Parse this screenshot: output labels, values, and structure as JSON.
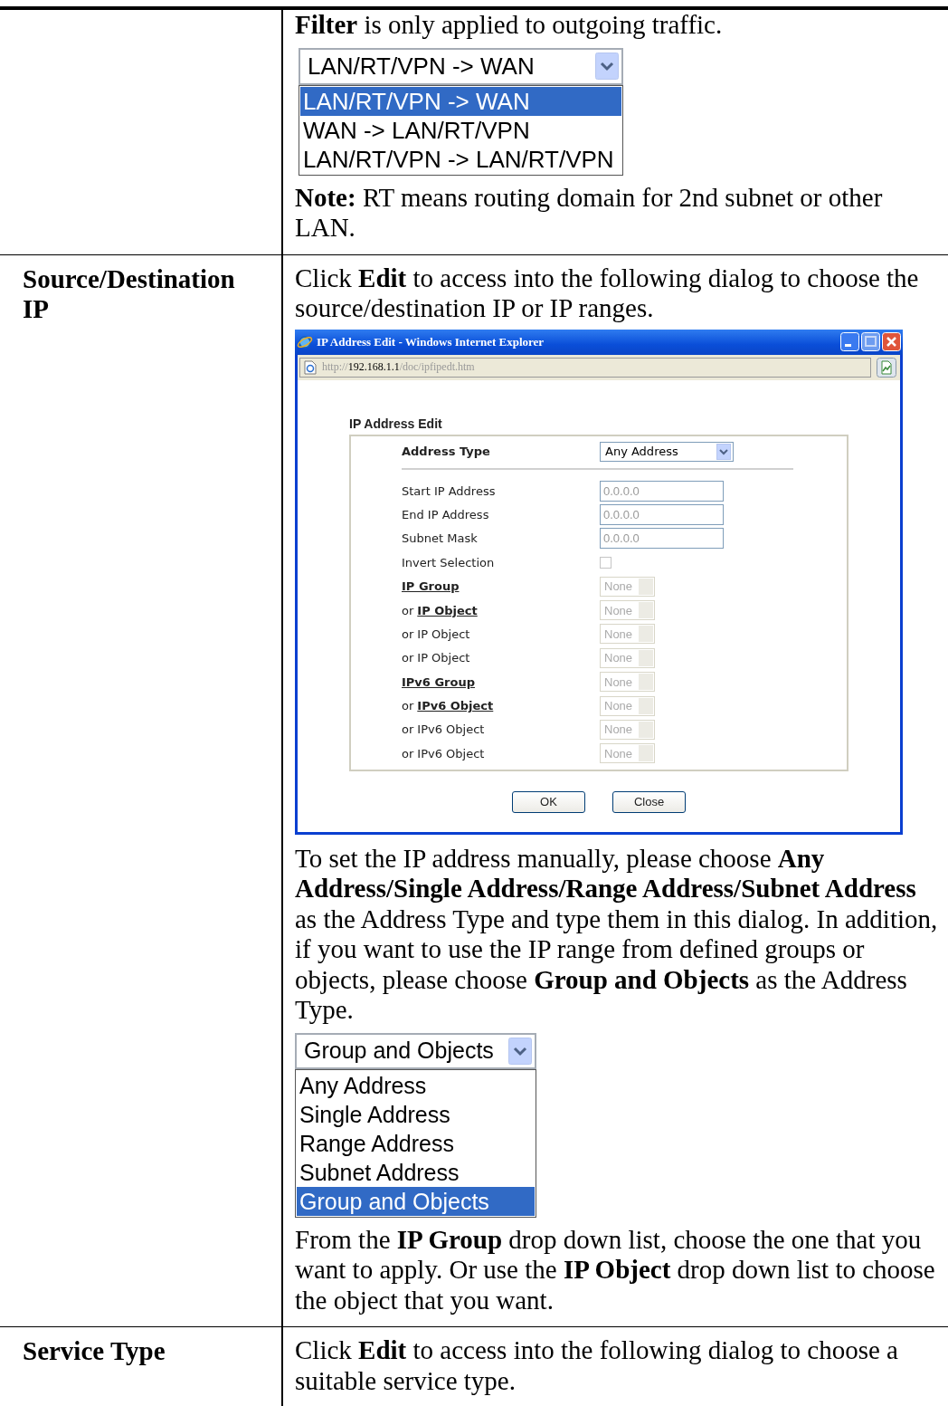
{
  "rows": [
    {
      "label": "",
      "blocks": [
        {
          "kind": "paragraph",
          "text": "**Filter** is only applied to outgoing traffic."
        },
        {
          "kind": "dropdown",
          "value": "LAN/RT/VPN -> WAN",
          "options": [
            {
              "label": "LAN/RT/VPN -> WAN",
              "selected": true
            },
            {
              "label": "WAN -> LAN/RT/VPN",
              "selected": false
            },
            {
              "label": "LAN/RT/VPN -> LAN/RT/VPN",
              "selected": false
            }
          ]
        },
        {
          "kind": "paragraph",
          "text": "**Note:** RT means routing domain for 2nd subnet or other LAN."
        }
      ]
    },
    {
      "label": "Source/Destination IP",
      "blocks": [
        {
          "kind": "paragraph",
          "text": "Click **Edit** to access into the following dialog to choose the source/destination IP or IP ranges."
        },
        {
          "kind": "dialog",
          "title": "IP Address Edit - Windows Internet Explorer",
          "url_scheme": "http://",
          "url_host": "192.168.1.1",
          "url_path": "/doc/ipfipedt.htm",
          "heading": "IP Address Edit",
          "address_type": {
            "label": "Address Type",
            "value": "Any Address"
          },
          "fields": [
            {
              "label": "Start IP Address",
              "link": false,
              "kind": "input",
              "value": "0.0.0.0",
              "disabled": true
            },
            {
              "label": "End IP Address",
              "link": false,
              "kind": "input",
              "value": "0.0.0.0",
              "disabled": true
            },
            {
              "label": "Subnet Mask",
              "link": false,
              "kind": "input",
              "value": "0.0.0.0",
              "disabled": true
            },
            {
              "label": "Invert Selection",
              "link": false,
              "kind": "checkbox",
              "checked": false
            },
            {
              "label": "IP Group",
              "link": true,
              "kind": "select",
              "value": "None",
              "disabled": true
            },
            {
              "prefix": "or",
              "label": "IP Object",
              "link": true,
              "kind": "select",
              "value": "None",
              "disabled": true
            },
            {
              "prefix": "or",
              "label": "IP Object",
              "link": false,
              "kind": "select",
              "value": "None",
              "disabled": true
            },
            {
              "prefix": "or",
              "label": "IP Object",
              "link": false,
              "kind": "select",
              "value": "None",
              "disabled": true
            },
            {
              "label": "IPv6 Group",
              "link": true,
              "kind": "select",
              "value": "None",
              "disabled": true
            },
            {
              "prefix": "or",
              "label": "IPv6 Object",
              "link": true,
              "kind": "select",
              "value": "None",
              "disabled": true
            },
            {
              "prefix": "or",
              "label": "IPv6 Object",
              "link": false,
              "kind": "select",
              "value": "None",
              "disabled": true
            },
            {
              "prefix": "or",
              "label": "IPv6 Object",
              "link": false,
              "kind": "select",
              "value": "None",
              "disabled": true
            }
          ],
          "buttons": [
            "OK",
            "Close"
          ]
        },
        {
          "kind": "paragraph",
          "text": "To set the IP address manually, please choose **Any Address/Single Address/Range Address/Subnet Address** as the Address Type and type them in this dialog. In addition, if you want to use the IP range from defined groups or objects, please choose **Group and Objects** as the Address Type."
        },
        {
          "kind": "dropdown",
          "value": "Group and Objects",
          "options": [
            {
              "label": "Any Address",
              "selected": false
            },
            {
              "label": "Single Address",
              "selected": false
            },
            {
              "label": "Range Address",
              "selected": false
            },
            {
              "label": "Subnet Address",
              "selected": false
            },
            {
              "label": "Group and Objects",
              "selected": true
            }
          ]
        },
        {
          "kind": "paragraph",
          "text": "From the **IP Group** drop down list, choose the one that you want to apply. Or use the **IP Object** drop down list to choose the object that you want."
        }
      ]
    },
    {
      "label": "Service Type",
      "blocks": [
        {
          "kind": "paragraph",
          "text": "Click **Edit** to access into the following dialog to choose a suitable service type."
        }
      ]
    }
  ]
}
